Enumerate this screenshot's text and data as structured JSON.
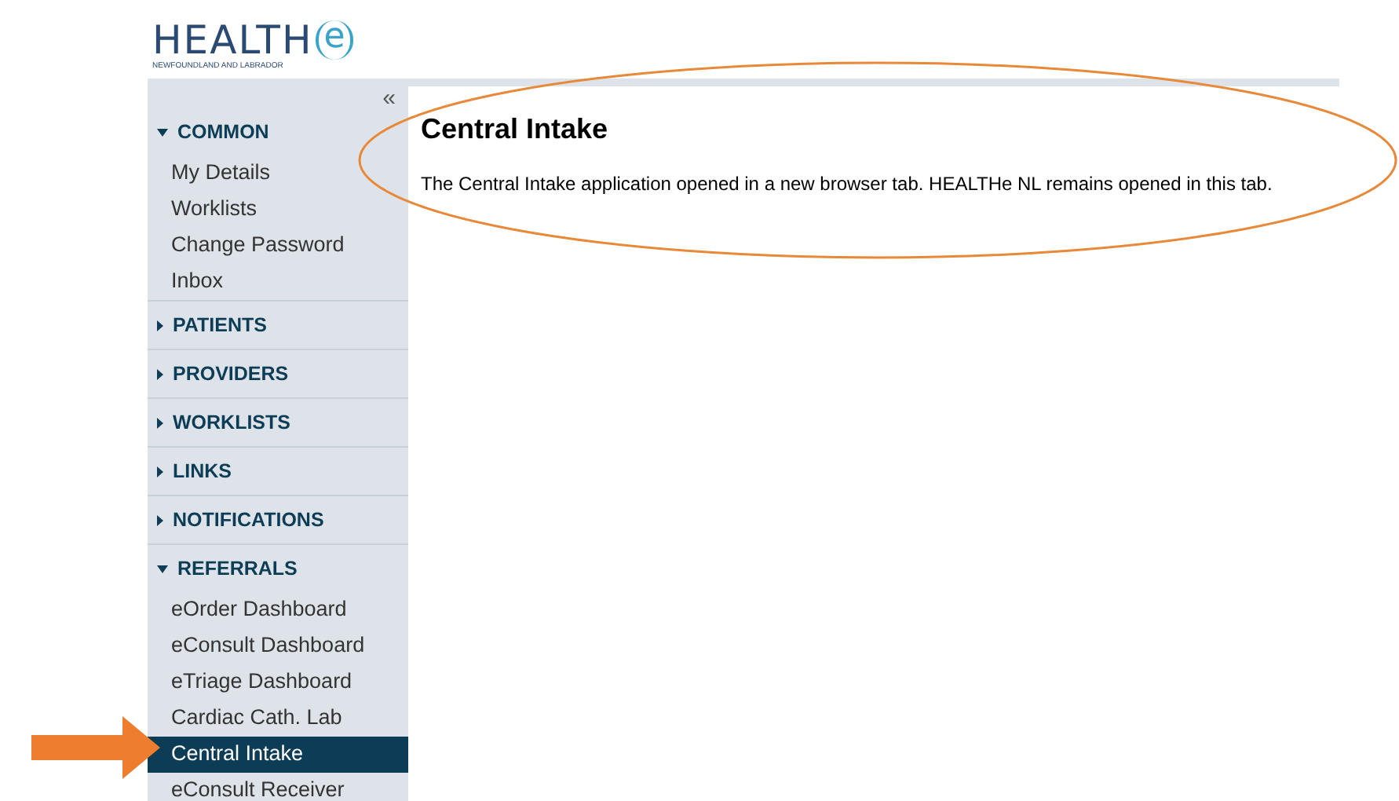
{
  "logo": {
    "name": "HEALTH",
    "badge": "e",
    "tagline": "NEWFOUNDLAND AND LABRADOR"
  },
  "sidebar": {
    "collapse": "«",
    "sections": [
      {
        "label": "COMMON",
        "expanded": true,
        "items": [
          {
            "label": "My Details",
            "selected": false
          },
          {
            "label": "Worklists",
            "selected": false
          },
          {
            "label": "Change Password",
            "selected": false
          },
          {
            "label": "Inbox",
            "selected": false
          }
        ]
      },
      {
        "label": "PATIENTS",
        "expanded": false
      },
      {
        "label": "PROVIDERS",
        "expanded": false
      },
      {
        "label": "WORKLISTS",
        "expanded": false
      },
      {
        "label": "LINKS",
        "expanded": false
      },
      {
        "label": "NOTIFICATIONS",
        "expanded": false
      },
      {
        "label": "REFERRALS",
        "expanded": true,
        "items": [
          {
            "label": "eOrder Dashboard",
            "selected": false
          },
          {
            "label": "eConsult Dashboard",
            "selected": false
          },
          {
            "label": "eTriage Dashboard",
            "selected": false
          },
          {
            "label": "Cardiac Cath. Lab",
            "selected": false
          },
          {
            "label": "Central Intake",
            "selected": true
          },
          {
            "label": "eConsult Receiver",
            "selected": false
          }
        ]
      }
    ]
  },
  "content": {
    "title": "Central Intake",
    "message": "The Central Intake application opened in a new browser tab. HEALTHe NL remains opened in this tab."
  }
}
